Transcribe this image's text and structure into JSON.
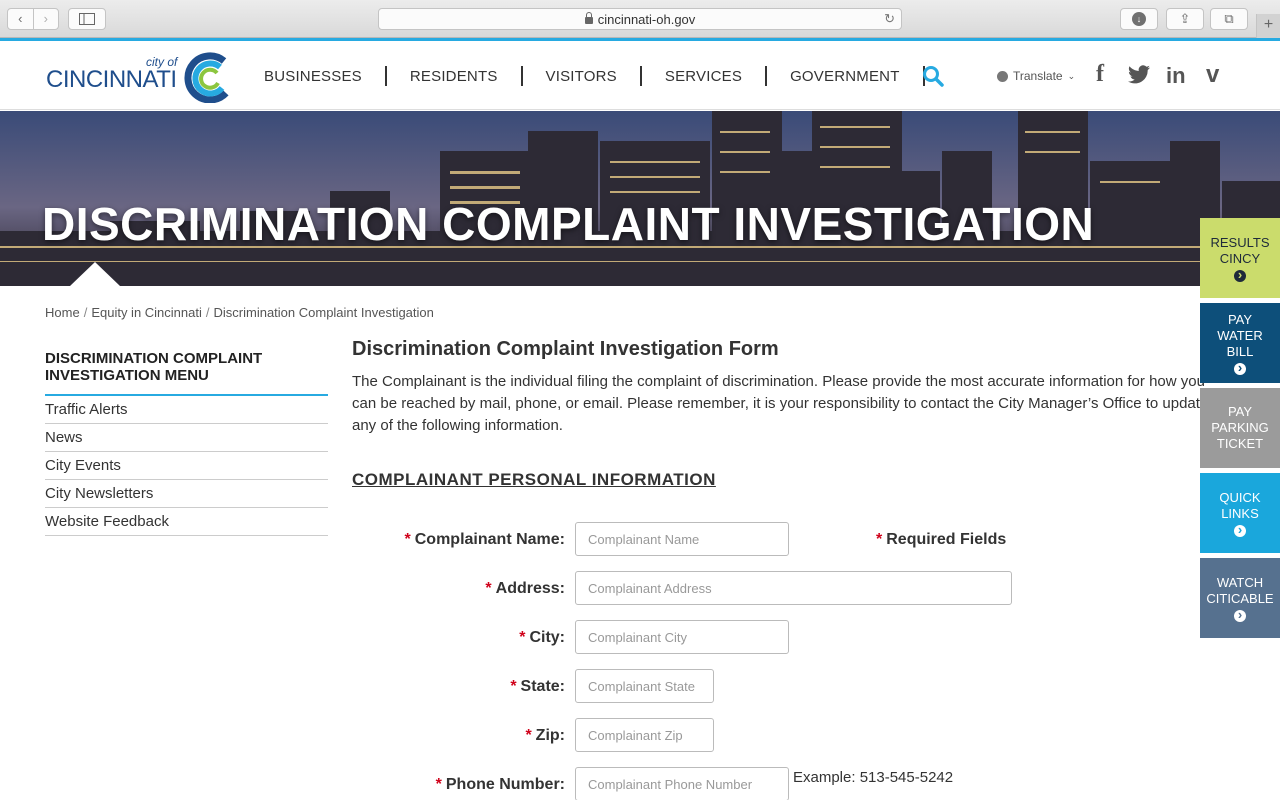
{
  "browser": {
    "url": "cincinnati-oh.gov",
    "back_glyph": "‹",
    "forward_glyph": "›",
    "reload_glyph": "↻",
    "download_glyph": "↓",
    "share_glyph": "⇪",
    "tabs_glyph": "⧉",
    "newtab_glyph": "+"
  },
  "header": {
    "logo_cityof": "city of",
    "logo_name": "CINCINNATI",
    "nav": [
      "BUSINESSES",
      "RESIDENTS",
      "VISITORS",
      "SERVICES",
      "GOVERNMENT"
    ],
    "translate_label": "Translate",
    "translate_chevron": "⌄",
    "social": {
      "facebook": "f",
      "linkedin": "in",
      "vimeo": "v"
    },
    "accent_color": "#27aae1"
  },
  "hero": {
    "title": "DISCRIMINATION COMPLAINT INVESTIGATION"
  },
  "breadcrumb": {
    "home": "Home",
    "section": "Equity in Cincinnati",
    "current": "Discrimination Complaint Investigation",
    "separator": "/"
  },
  "leftmenu": {
    "title": "DISCRIMINATION COMPLAINT INVESTIGATION MENU",
    "items": [
      "Traffic Alerts",
      "News",
      "City Events",
      "City Newsletters",
      "Website Feedback"
    ]
  },
  "content": {
    "form_title": "Discrimination Complaint Investigation Form",
    "intro": "The Complainant is the individual filing the complaint of discrimination. Please provide the most accurate information for how you can be reached by mail, phone, or email. Please remember, it is your responsibility to contact the City Manager’s Office to update any of the following information.",
    "section_title": "COMPLAINANT PERSONAL INFORMATION",
    "required_mark": "*",
    "required_note": "Required Fields",
    "fields": {
      "name": {
        "label": "Complainant Name:",
        "placeholder": "Complainant Name",
        "value": ""
      },
      "address": {
        "label": "Address:",
        "placeholder": "Complainant Address",
        "value": ""
      },
      "city": {
        "label": "City:",
        "placeholder": "Complainant City",
        "value": ""
      },
      "state": {
        "label": "State:",
        "placeholder": "Complainant State",
        "value": ""
      },
      "zip": {
        "label": "Zip:",
        "placeholder": "Complainant Zip",
        "value": ""
      },
      "phone": {
        "label": "Phone Number:",
        "placeholder": "Complainant Phone Number",
        "value": ""
      }
    },
    "phone_example": "Example: 513-545-5242"
  },
  "tiles": [
    {
      "lines": [
        "RESULTS",
        "CINCY"
      ],
      "color": "#cbdc6c"
    },
    {
      "lines": [
        "PAY",
        "WATER",
        "BILL"
      ],
      "color": "#0d4f7a"
    },
    {
      "lines": [
        "PAY",
        "PARKING",
        "TICKET"
      ],
      "color": "#9b9b9b"
    },
    {
      "lines": [
        "QUICK",
        "LINKS"
      ],
      "color": "#1aa7dc"
    },
    {
      "lines": [
        "WATCH",
        "CITICABLE"
      ],
      "color": "#56718f"
    }
  ]
}
